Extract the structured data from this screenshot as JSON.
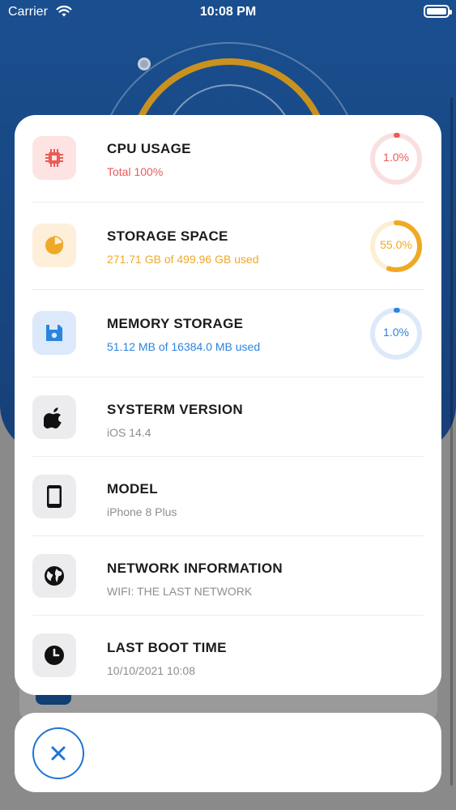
{
  "status_bar": {
    "carrier": "Carrier",
    "time": "10:08 PM"
  },
  "rows": [
    {
      "title": "CPU USAGE",
      "subtitle": "Total 100%",
      "ring_label": "1.0%",
      "percent": 1.0,
      "color": "#eb5a5a",
      "track": "#f9e0e0",
      "icon": "chip-icon",
      "icon_bg": "#fde3e1"
    },
    {
      "title": "STORAGE SPACE",
      "subtitle": "271.71 GB of 499.96 GB used",
      "ring_label": "55.0%",
      "percent": 55.0,
      "color": "#f0a925",
      "track": "#fbefd6",
      "icon": "pie-chart-icon",
      "icon_bg": "#fdefd9"
    },
    {
      "title": "MEMORY STORAGE",
      "subtitle": "51.12 MB of 16384.0 MB used",
      "ring_label": "1.0%",
      "percent": 1.0,
      "color": "#2a84e0",
      "track": "#dde9fa",
      "icon": "floppy-disk-icon",
      "icon_bg": "#dce9fb"
    },
    {
      "title": "SYSTERM VERSION",
      "subtitle": "iOS 14.4",
      "icon": "apple-logo-icon",
      "icon_bg": "#ececee"
    },
    {
      "title": "MODEL",
      "subtitle": "iPhone 8 Plus",
      "icon": "phone-icon",
      "icon_bg": "#ececee"
    },
    {
      "title": "NETWORK INFORMATION",
      "subtitle": "WIFI: THE LAST NETWORK",
      "icon": "globe-icon",
      "icon_bg": "#ececee"
    },
    {
      "title": "LAST BOOT TIME",
      "subtitle": "10/10/2021 10:08",
      "icon": "clock-icon",
      "icon_bg": "#ececee"
    }
  ],
  "close_button": {
    "icon": "close-icon",
    "color": "#1f74d4"
  },
  "theme": {
    "text_primary": "#1c1c1e",
    "text_secondary": "#8e8e93"
  }
}
